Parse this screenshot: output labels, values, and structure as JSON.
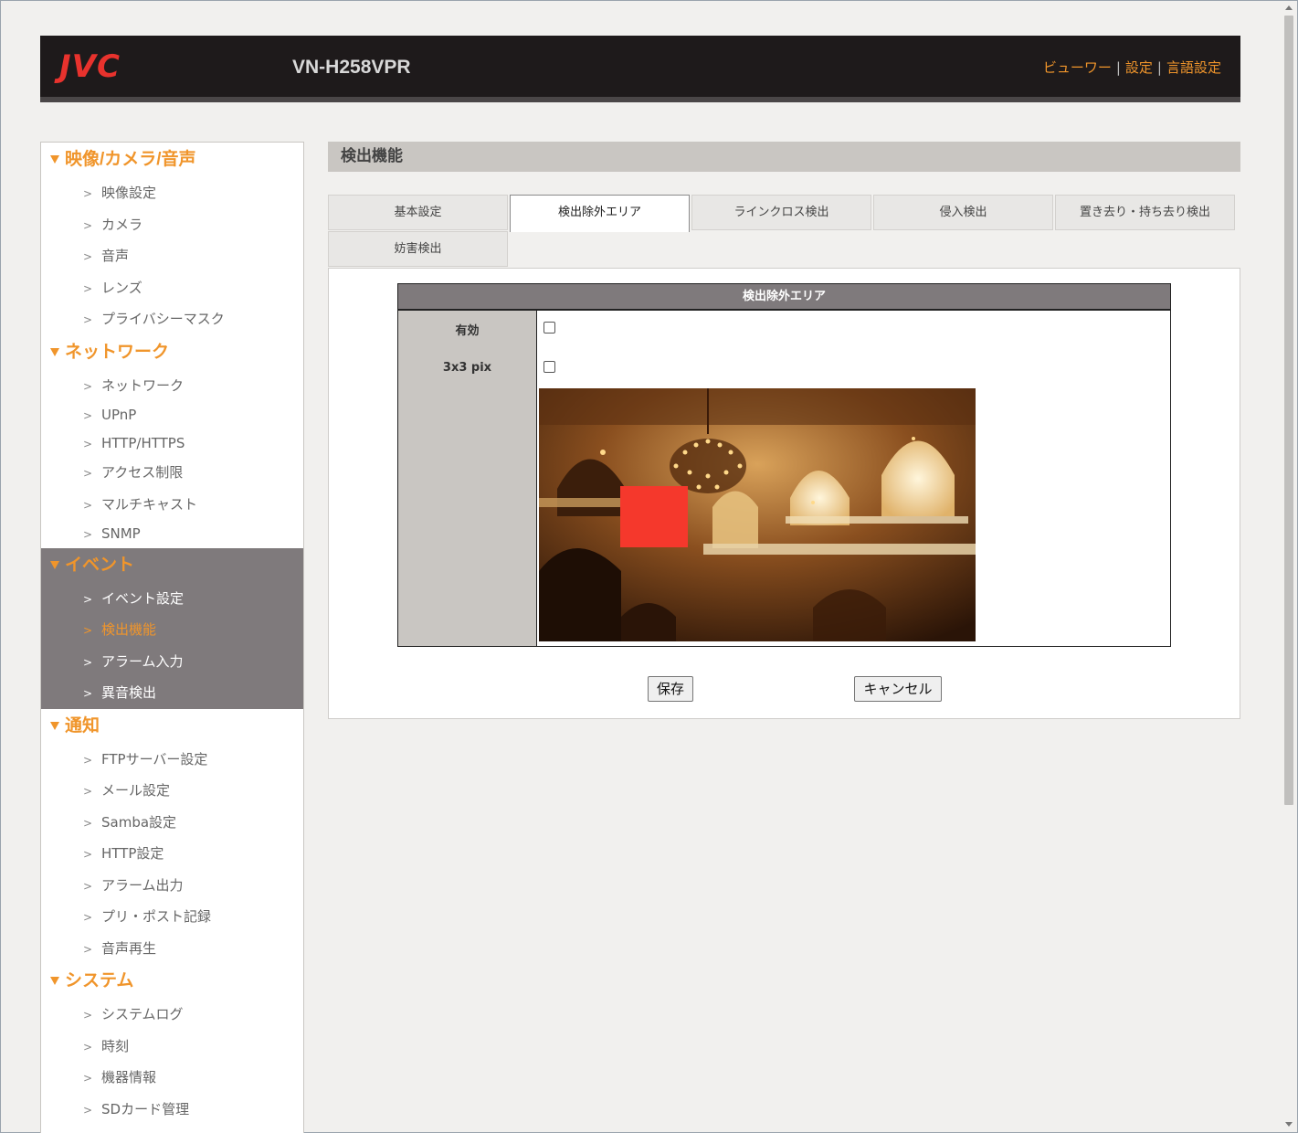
{
  "header": {
    "logo": "JVC",
    "model": "VN-H258VPR",
    "links": [
      "ビューワー",
      "設定",
      "言語設定"
    ]
  },
  "sidebar": {
    "sections": [
      {
        "title": "映像/カメラ/音声",
        "items": [
          "映像設定",
          "カメラ",
          "音声",
          "レンズ",
          "プライバシーマスク"
        ]
      },
      {
        "title": "ネットワーク",
        "items": [
          "ネットワーク",
          "UPnP",
          "HTTP/HTTPS",
          "アクセス制限",
          "マルチキャスト",
          "SNMP"
        ]
      },
      {
        "title": "イベント",
        "items": [
          "イベント設定",
          "検出機能",
          "アラーム入力",
          "異音検出"
        ]
      },
      {
        "title": "通知",
        "items": [
          "FTPサーバー設定",
          "メール設定",
          "Samba設定",
          "HTTP設定",
          "アラーム出力",
          "プリ・ポスト記録",
          "音声再生"
        ]
      },
      {
        "title": "システム",
        "items": [
          "システムログ",
          "時刻",
          "機器情報",
          "SDカード管理"
        ]
      }
    ]
  },
  "main": {
    "page_title": "検出機能",
    "tabs": [
      "基本設定",
      "検出除外エリア",
      "ラインクロス検出",
      "侵入検出",
      "置き去り・持ち去り検出",
      "妨害検出"
    ],
    "active_tab": "検出除外エリア",
    "form": {
      "header": "検出除外エリア",
      "enable_label": "有効",
      "enable_checked": false,
      "pix_label": "3x3 pix",
      "pix_checked": false
    },
    "buttons": {
      "save": "保存",
      "cancel": "キャンセル"
    }
  },
  "colors": {
    "accent": "#f0952b",
    "header_bg": "#1e1a1b",
    "active_section_bg": "#7f7a7c",
    "roi": "#f5382c"
  }
}
